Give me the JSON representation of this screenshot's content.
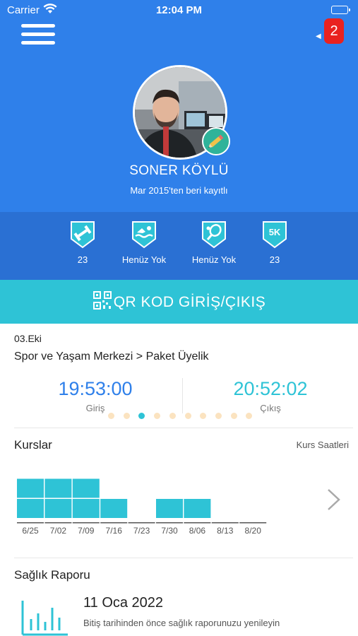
{
  "status_bar": {
    "carrier": "Carrier",
    "time": "12:04 PM"
  },
  "header": {
    "notification_count": "2",
    "user_name": "SONER KÖYLÜ",
    "member_since": "Mar 2015'ten beri kayıtlı",
    "colors": {
      "primary": "#2f80ea",
      "badge_row": "#2a70d3",
      "accent": "#2ec3d6",
      "edit": "#2fb39a",
      "badge_red": "#e9221f"
    }
  },
  "achievements": [
    {
      "icon": "dumbbell-badge-icon",
      "label": "23"
    },
    {
      "icon": "swimming-badge-icon",
      "label": "Henüz Yok"
    },
    {
      "icon": "tennis-badge-icon",
      "label": "Henüz Yok"
    },
    {
      "icon": "5k-badge-icon",
      "badge_text": "5K",
      "label": "23"
    }
  ],
  "qr": {
    "label": "QR KOD GİRİŞ/ÇIKIŞ"
  },
  "entry": {
    "date": "03.Eki",
    "place": "Spor ve Yaşam Merkezi > Paket Üyelik",
    "checkin_time": "19:53:00",
    "checkin_label": "Giriş",
    "checkout_time": "20:52:02",
    "checkout_label": "Çıkış",
    "pager": {
      "total": 10,
      "active_index": 2
    }
  },
  "courses": {
    "title": "Kurslar",
    "link": "Kurs Saatleri"
  },
  "chart_data": {
    "type": "bar",
    "categories": [
      "6/25",
      "7/02",
      "7/09",
      "7/16",
      "7/23",
      "7/30",
      "8/06",
      "8/13",
      "8/20"
    ],
    "values": [
      2,
      2,
      2,
      1,
      0,
      1,
      1,
      0,
      0
    ],
    "title": "",
    "xlabel": "",
    "ylabel": "",
    "ylim": [
      0,
      2
    ],
    "grid": false,
    "legend": "none",
    "color": "#2ec3d6"
  },
  "health": {
    "title": "Sağlık Raporu",
    "date": "11 Oca 2022",
    "note": "Bitiş tarihinden önce sağlık raporunuzu yenileyin"
  }
}
